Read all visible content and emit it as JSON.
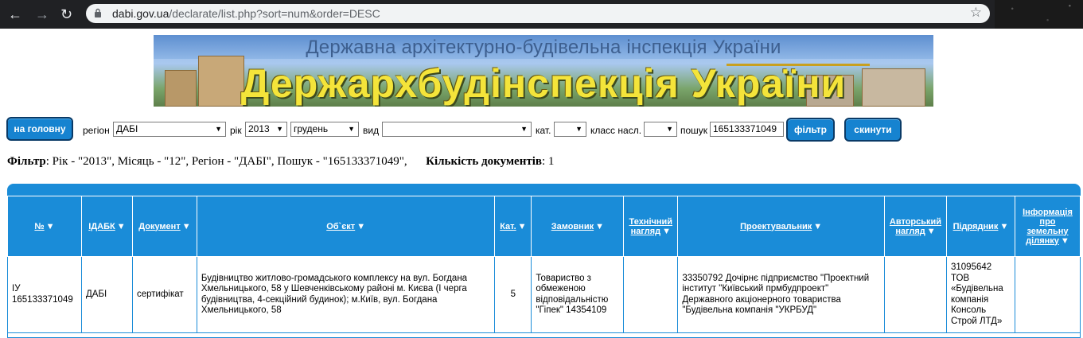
{
  "browser": {
    "url_host": "dabi.gov.ua",
    "url_path": "/declarate/list.php?sort=num&order=DESC"
  },
  "banner": {
    "subtitle": "Державна архітектурно-будівельна інспекція України",
    "title": "Держархбудінспекція України"
  },
  "toolbar": {
    "home_button": "на головну",
    "region_label": "регіон",
    "region_value": "ДАБІ",
    "year_label": "рік",
    "year_value": "2013",
    "month_value": "грудень",
    "kind_label": "вид",
    "kind_value": "",
    "cat_label": "кат.",
    "cat_value": "",
    "class_label": "класс насл.",
    "class_value": "",
    "search_label": "пошук",
    "search_value": "165133371049",
    "filter_button": "фільтр",
    "reset_button": "скинути"
  },
  "filter_summary": {
    "filter_label": "Фільтр",
    "filter_text": ": Рік - \"2013\", Місяць - \"12\", Регіон - \"ДАБІ\", Пошук - \"165133371049\",",
    "count_label": "Кількість документів",
    "count_text": ": 1"
  },
  "table": {
    "headers": [
      "№",
      "ІДАБК",
      "Документ",
      "Об`єкт",
      "Кат.",
      "Замовник",
      "Технічний нагляд",
      "Проектувальник",
      "Авторський нагляд",
      "Підрядник",
      "Інформація про земельну ділянку"
    ],
    "rows": [
      {
        "num": "ІУ 165133371049",
        "idabk": "ДАБІ",
        "doc": "сертифікат",
        "object": "Будівництво житлово-громадського комплексу на вул. Богдана Хмельницького, 58 у Шевченківському районі м. Києва (І черга будівництва, 4-секційний будинок); м.Київ, вул. Богдана Хмельницького, 58",
        "cat": "5",
        "customer": "Товариство з обмеженою відповідальністю \"Гіпек\" 14354109",
        "tech": "",
        "designer": "33350792 Дочірнє підприємство \"Проектний інститут \"Київський прмбудпроект\" Державного акціонерного товариства \"Будівельна компанія \"УКРБУД\"",
        "author": "",
        "contractor": "31095642 ТОВ «Будівельна компанія Консоль Строй ЛТД»",
        "land": ""
      }
    ]
  },
  "colors": {
    "accent": "#1a8cd8",
    "button": "#1683d0",
    "chrome": "#202124"
  }
}
